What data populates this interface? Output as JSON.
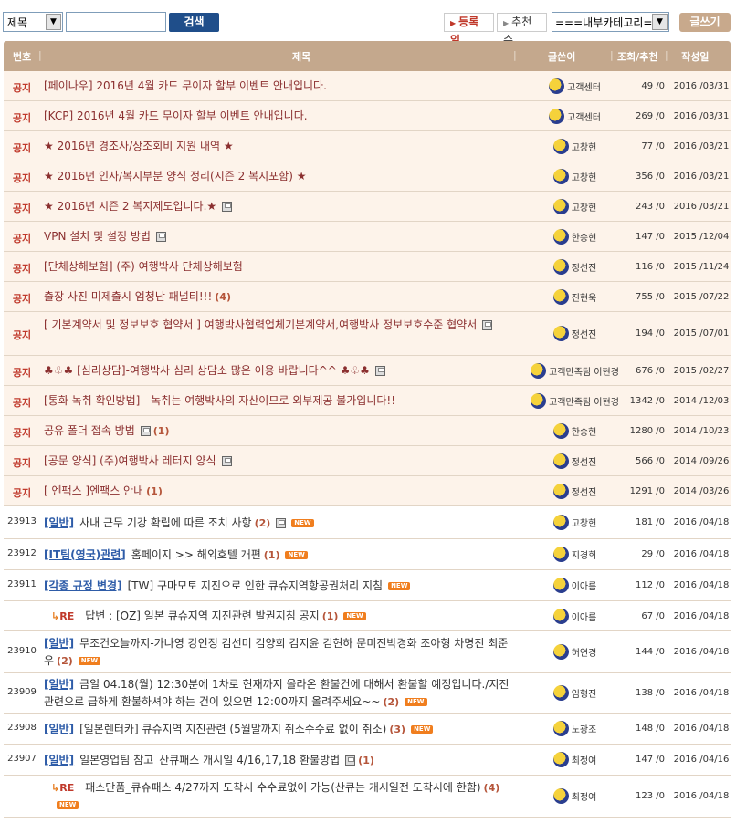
{
  "toolbar": {
    "search_field": "제목",
    "search_value": "",
    "search_button": "검색",
    "sort_registered": "등록일",
    "sort_recommend": "추천수",
    "category_select": "===내부카테고리==",
    "write_button": "글쓰기"
  },
  "header": {
    "num": "번호",
    "title": "제목",
    "author": "글쓴이",
    "views": "조회/추천",
    "date": "작성일"
  },
  "rows": [
    {
      "num": "공지",
      "notice": true,
      "title": "[페이나우] 2016년 4월 카드 무이자 할부 이벤트 안내입니다.",
      "author": "고객센터",
      "views": "49 /0",
      "date": "2016 /03/31"
    },
    {
      "num": "공지",
      "notice": true,
      "title": "[KCP] 2016년 4월 카드 무이자 할부 이벤트 안내입니다.",
      "author": "고객센터",
      "views": "269 /0",
      "date": "2016 /03/31"
    },
    {
      "num": "공지",
      "notice": true,
      "title": "★ 2016년 경조사/상조회비 지원 내역 ★",
      "author": "고창헌",
      "views": "77 /0",
      "date": "2016 /03/21"
    },
    {
      "num": "공지",
      "notice": true,
      "title": "★ 2016년 인사/복지부분 양식 정리(시즌 2 복지포함) ★",
      "author": "고창헌",
      "views": "356 /0",
      "date": "2016 /03/21"
    },
    {
      "num": "공지",
      "notice": true,
      "title": "★ 2016년 시즌 2 복지제도입니다.★",
      "disk": true,
      "author": "고창헌",
      "views": "243 /0",
      "date": "2016 /03/21"
    },
    {
      "num": "공지",
      "notice": true,
      "title": "VPN 설치 및 설정 방법",
      "disk": true,
      "author": "한승현",
      "views": "147 /0",
      "date": "2015 /12/04"
    },
    {
      "num": "공지",
      "notice": true,
      "title": "[단체상해보험] (주) 여행박사 단체상해보험",
      "author": "정선진",
      "views": "116 /0",
      "date": "2015 /11/24"
    },
    {
      "num": "공지",
      "notice": true,
      "title": "출장 사진 미제출시 엄청난 패널티!!!",
      "comments": "(4)",
      "author": "진현욱",
      "views": "755 /0",
      "date": "2015 /07/22"
    },
    {
      "num": "공지",
      "notice": true,
      "title": "[ 기본계약서 및 정보보호 협약서 ] 여행박사협력업체기본계약서,여행박사 정보보호수준 협약서",
      "disk": true,
      "author": "정선진",
      "views": "194 /0",
      "date": "2015 /07/01",
      "tall": true
    },
    {
      "num": "공지",
      "notice": true,
      "title": "♣♧♣ [심리상담]-여행박사 심리 상담소 많은 이용 바랍니다^^ ♣♧♣",
      "disk": true,
      "author": "고객만족팀 이현경",
      "views": "676 /0",
      "date": "2015 /02/27"
    },
    {
      "num": "공지",
      "notice": true,
      "title": "[통화 녹취 확인방법] - 녹취는 여행박사의 자산이므로 외부제공 불가입니다!!",
      "author": "고객만족팀 이현경",
      "views": "1342 /0",
      "date": "2014 /12/03"
    },
    {
      "num": "공지",
      "notice": true,
      "title": "공유 폴더 접속 방법",
      "disk": true,
      "comments": "(1)",
      "author": "한승현",
      "views": "1280 /0",
      "date": "2014 /10/23"
    },
    {
      "num": "공지",
      "notice": true,
      "title": "[공문 양식] (주)여행박사 레터지 양식",
      "disk": true,
      "author": "정선진",
      "views": "566 /0",
      "date": "2014 /09/26"
    },
    {
      "num": "공지",
      "notice": true,
      "title": "[ 엔팩스 ]엔팩스 안내",
      "comments": "(1)",
      "author": "정선진",
      "views": "1291 /0",
      "date": "2014 /03/26"
    },
    {
      "num": "23913",
      "category": "[일반]",
      "title": "사내 근무 기강 확립에 따른 조치 사항",
      "comments": "(2)",
      "disk": true,
      "isnew": true,
      "author": "고창헌",
      "views": "181 /0",
      "date": "2016 /04/18"
    },
    {
      "num": "23912",
      "category": "[IT팀(영국)관련]",
      "title": "홈페이지 >> 해외호텔 개편",
      "comments": "(1)",
      "isnew": true,
      "author": "지경희",
      "views": "29 /0",
      "date": "2016 /04/18"
    },
    {
      "num": "23911",
      "category": "[각종 규정 변경]",
      "title": "[TW] 구마모토 지진으로 인한 큐슈지역항공권처리 지침",
      "isnew": true,
      "author": "이아름",
      "views": "112 /0",
      "date": "2016 /04/18"
    },
    {
      "num": "",
      "reply": true,
      "title": "답변 : [OZ] 일본 큐슈지역 지진관련 발권지침 공지",
      "comments": "(1)",
      "isnew": true,
      "author": "이아름",
      "views": "67 /0",
      "date": "2016 /04/18"
    },
    {
      "num": "23910",
      "category": "[일반]",
      "title": "무조건오늘까지-가나영 강인정 김선미 김양희 김지윤 김현하 문미진박경화 조아형 차명진 최준우",
      "comments": "(2)",
      "isnew": true,
      "author": "허연경",
      "views": "144 /0",
      "date": "2016 /04/18",
      "tall": true
    },
    {
      "num": "23909",
      "category": "[일반]",
      "title": "금일 04.18(월) 12:30분에 1차로 현재까지 올라온 환불건에 대해서 환불할 예정입니다./지진관련으로 급하게 환불하셔야 하는 건이 있으면 12:00까지 올려주세요~~",
      "comments": "(2)",
      "isnew": true,
      "author": "임형진",
      "views": "138 /0",
      "date": "2016 /04/18",
      "tall": true
    },
    {
      "num": "23908",
      "category": "[일반]",
      "title": "[일본렌터카] 큐슈지역 지진관련 (5월말까지 취소수수료 없이 취소)",
      "comments": "(3)",
      "isnew": true,
      "author": "노광조",
      "views": "148 /0",
      "date": "2016 /04/18"
    },
    {
      "num": "23907",
      "category": "[일반]",
      "title": "일본영업팀 참고_산큐패스 개시일 4/16,17,18 환불방법",
      "comments": "(1)",
      "disk": true,
      "author": "최정여",
      "views": "147 /0",
      "date": "2016 /04/16"
    },
    {
      "num": "",
      "reply": true,
      "title": "패스단품_큐슈패스 4/27까지 도착시 수수료없이 가능(산큐는 개시일전 도착시에 한함)",
      "comments": "(4)",
      "isnew": true,
      "author": "최정여",
      "views": "123 /0",
      "date": "2016 /04/18",
      "tall": true
    }
  ],
  "labels": {
    "re": "RE",
    "new": "NEW"
  }
}
